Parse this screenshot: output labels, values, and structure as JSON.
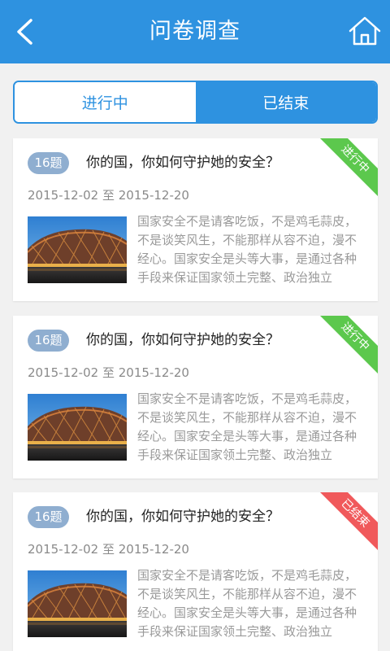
{
  "header": {
    "title": "问卷调查",
    "back_icon": "chevron-left-icon",
    "home_icon": "home-icon"
  },
  "tabs": [
    {
      "label": "进行中",
      "state": "selected"
    },
    {
      "label": "已结束",
      "state": "unselected"
    }
  ],
  "colors": {
    "primary": "#2e92e0",
    "badge": "#8faed0",
    "ongoing": "#5cc84d",
    "ended": "#f0595b"
  },
  "surveys": [
    {
      "count": "16题",
      "title": "你的国，你如何守护她的安全？",
      "start": "2015-12-02",
      "sep": "至",
      "end": "2015-12-20",
      "description": "国家安全不是请客吃饭，不是鸡毛蒜皮，不是谈笑风生，不能那样从容不迫，漫不经心。国家安全是头等大事，是通过各种手段来保证国家领土完整、政治独立",
      "status": "进行中",
      "status_color": "#5cc84d"
    },
    {
      "count": "16题",
      "title": "你的国，你如何守护她的安全？",
      "start": "2015-12-02",
      "sep": "至",
      "end": "2015-12-20",
      "description": "国家安全不是请客吃饭，不是鸡毛蒜皮，不是谈笑风生，不能那样从容不迫，漫不经心。国家安全是头等大事，是通过各种手段来保证国家领土完整、政治独立",
      "status": "进行中",
      "status_color": "#5cc84d"
    },
    {
      "count": "16题",
      "title": "你的国，你如何守护她的安全？",
      "start": "2015-12-02",
      "sep": "至",
      "end": "2015-12-20",
      "description": "国家安全不是请客吃饭，不是鸡毛蒜皮，不是谈笑风生，不能那样从容不迫，漫不经心。国家安全是头等大事，是通过各种手段来保证国家领土完整、政治独立",
      "status": "已结束",
      "status_color": "#f0595b"
    }
  ]
}
